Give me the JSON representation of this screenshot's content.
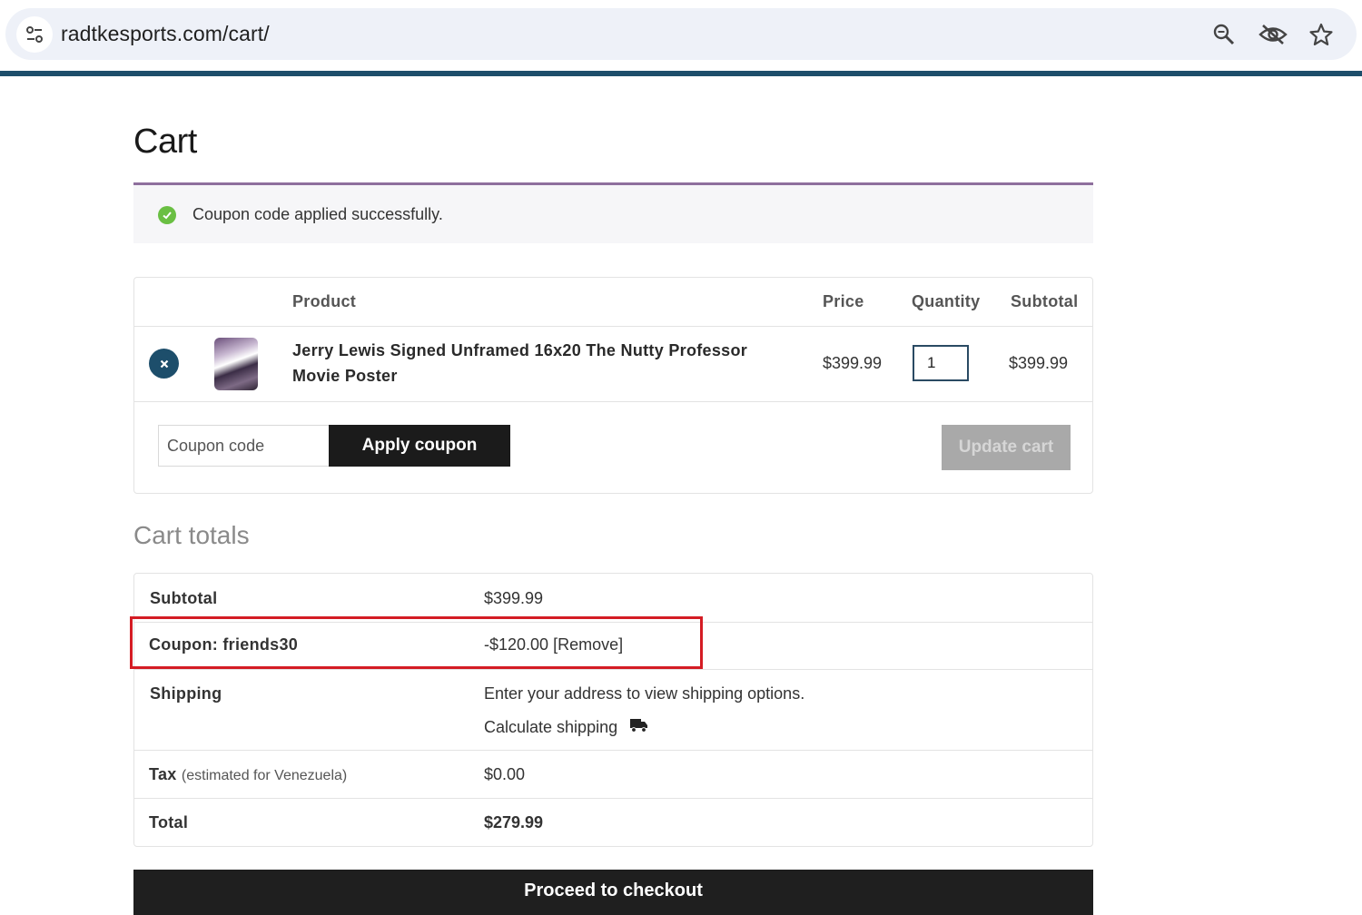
{
  "browser": {
    "url": "radtkesports.com/cart/"
  },
  "page": {
    "title": "Cart"
  },
  "notice": {
    "message": "Coupon code applied successfully."
  },
  "cart_table": {
    "headers": {
      "product": "Product",
      "price": "Price",
      "quantity": "Quantity",
      "subtotal": "Subtotal"
    },
    "items": [
      {
        "name_line1": "Jerry Lewis Signed Unframed 16x20 The Nutty Professor",
        "name_line2": "Movie Poster",
        "price": "$399.99",
        "quantity": "1",
        "subtotal": "$399.99"
      }
    ]
  },
  "actions": {
    "coupon_placeholder": "Coupon code",
    "apply_coupon": "Apply coupon",
    "update_cart": "Update cart"
  },
  "totals": {
    "title": "Cart totals",
    "subtotal_label": "Subtotal",
    "subtotal_value": "$399.99",
    "coupon_label": "Coupon: friends30",
    "coupon_value": "-$120.00",
    "coupon_remove": "[Remove]",
    "shipping_label": "Shipping",
    "shipping_note": "Enter your address to view shipping options.",
    "calculate_shipping": "Calculate shipping",
    "tax_label": "Tax",
    "tax_note": "(estimated for Venezuela)",
    "tax_value": "$0.00",
    "total_label": "Total",
    "total_value": "$279.99"
  },
  "checkout": {
    "label": "Proceed to checkout"
  },
  "colors": {
    "accent": "#1d4e6b",
    "notice_border": "#8e6f9d",
    "success": "#6abf43",
    "highlight": "#d41c24"
  }
}
